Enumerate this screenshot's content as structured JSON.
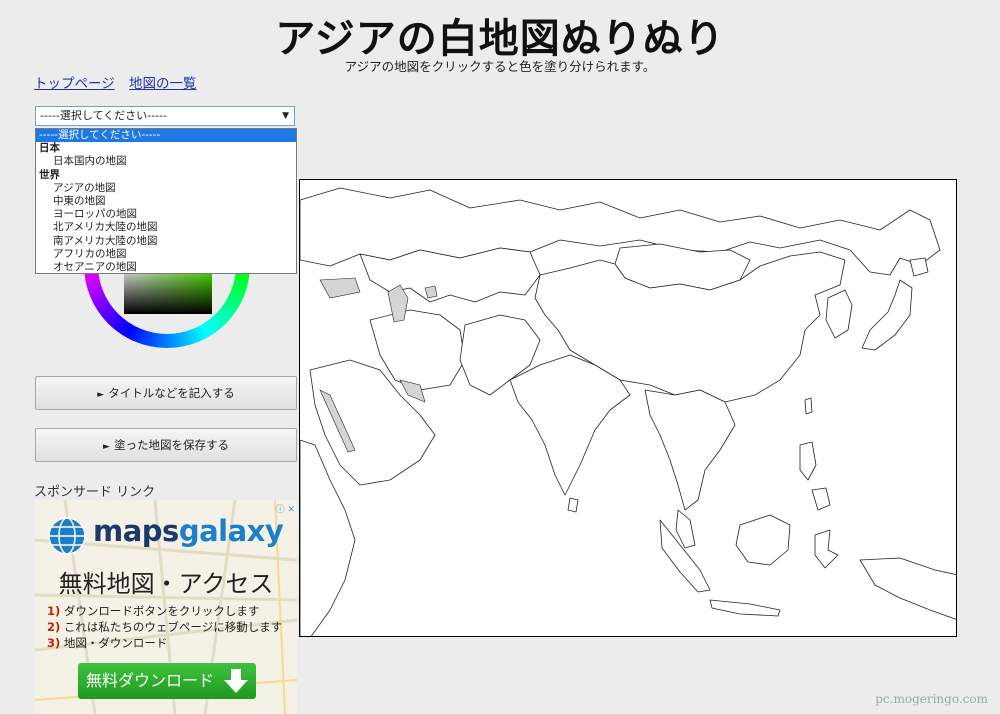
{
  "header": {
    "title": "アジアの白地図ぬりぬり",
    "subtitle": "アジアの地図をクリックすると色を塗り分けられます。"
  },
  "nav": {
    "links": [
      "トップページ",
      "地図の一覧"
    ]
  },
  "map_select": {
    "current": "-----選択してください-----",
    "options": [
      {
        "type": "selected",
        "label": "-----選択してください-----"
      },
      {
        "type": "group",
        "label": "日本"
      },
      {
        "type": "option",
        "label": "日本国内の地図"
      },
      {
        "type": "group",
        "label": "世界"
      },
      {
        "type": "option",
        "label": "アジアの地図"
      },
      {
        "type": "option",
        "label": "中東の地図"
      },
      {
        "type": "option",
        "label": "ヨーロッパの地図"
      },
      {
        "type": "option",
        "label": "北アメリカ大陸の地図"
      },
      {
        "type": "option",
        "label": "南アメリカ大陸の地図"
      },
      {
        "type": "option",
        "label": "アフリカの地図"
      },
      {
        "type": "option",
        "label": "オセアニアの地図"
      }
    ]
  },
  "color_picker": {
    "selected_color": "#55ff00"
  },
  "buttons": {
    "title_label": "タイトルなどを記入する",
    "save_label": "塗った地図を保存する"
  },
  "sponsor": {
    "label": "スポンサード リンク",
    "brand_part1": "maps",
    "brand_part2": "galaxy",
    "headline": "無料地図・アクセス",
    "steps": [
      {
        "num": "1)",
        "text": "ダウンロードボタンをクリックします"
      },
      {
        "num": "2)",
        "text": "これは私たちのウェブページに移動します"
      },
      {
        "num": "3)",
        "text": "地図・ダウンロード"
      }
    ],
    "cta": "無料ダウンロード"
  },
  "watermark": "pc.mogeringo.com",
  "colors": {
    "accent": "#1e78e6",
    "map_sea": "#ffffff",
    "map_land": "#ffffff",
    "cta_green": "#2daf2d"
  }
}
